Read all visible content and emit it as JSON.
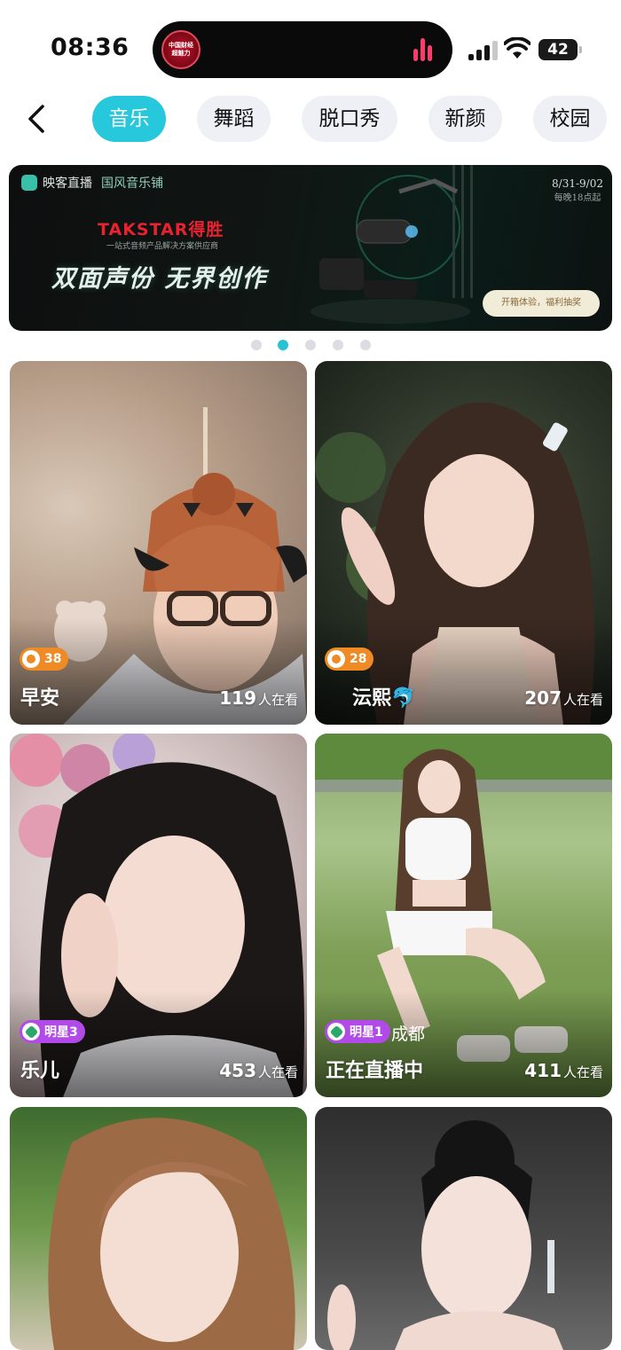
{
  "status_bar": {
    "time": "08:36",
    "island_logo_line1": "中国财经",
    "island_logo_line2": "超魅力",
    "battery": "42"
  },
  "tabs": [
    {
      "label": "音乐",
      "active": true
    },
    {
      "label": "舞蹈",
      "active": false
    },
    {
      "label": "脱口秀",
      "active": false
    },
    {
      "label": "新颜",
      "active": false
    },
    {
      "label": "校园",
      "active": false
    }
  ],
  "banner": {
    "app_name": "映客直播",
    "sub_brand": "国风音乐铺",
    "brand": "TAKSTAR得胜",
    "brand_tagline": "一站式音频产品解决方案供应商",
    "slogan": "双面声份 无界创作",
    "date": "8/31-9/02",
    "time_note": "每晚18点起",
    "promo": "开箱体验，福利抽奖"
  },
  "carousel": {
    "count": 5,
    "active_index": 1
  },
  "cards": [
    {
      "name": "早安",
      "badge": "38",
      "badge_type": "level",
      "city": "",
      "viewers": "119",
      "viewers_label": "人在看"
    },
    {
      "name": "沄熙🐬",
      "badge": "28",
      "badge_type": "level",
      "city": "",
      "viewers": "207",
      "viewers_label": "人在看"
    },
    {
      "name": "乐儿",
      "badge": "明星3",
      "badge_type": "star",
      "city": "",
      "viewers": "453",
      "viewers_label": "人在看"
    },
    {
      "name": "正在直播中",
      "badge": "明星1",
      "badge_type": "star",
      "city": "成都",
      "viewers": "411",
      "viewers_label": "人在看"
    },
    {
      "name": "",
      "badge": "",
      "badge_type": "",
      "city": "",
      "viewers": "",
      "viewers_label": ""
    },
    {
      "name": "",
      "badge": "",
      "badge_type": "",
      "city": "",
      "viewers": "",
      "viewers_label": ""
    }
  ],
  "colors": {
    "accent": "#27c7dc",
    "tab_bg": "#eef0f5",
    "level_badge": "#f08a24",
    "star_badge": "#b14ae8",
    "island_bars": "#ff3b6b"
  }
}
